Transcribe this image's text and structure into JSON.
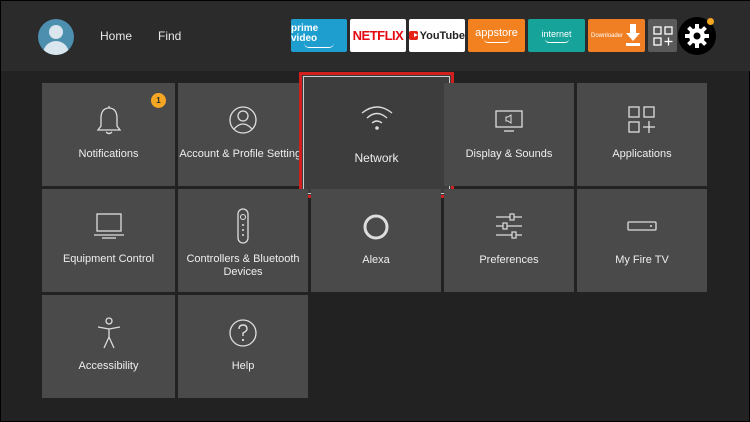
{
  "header": {
    "nav": [
      {
        "label": "Home"
      },
      {
        "label": "Find"
      }
    ],
    "apps": {
      "prime": "prime video",
      "netflix": "NETFLIX",
      "youtube": "YouTube",
      "appstore": "appstore",
      "internet": "internet",
      "downloader": "Downloader"
    }
  },
  "settings": {
    "tiles": [
      {
        "label": "Notifications",
        "badge": "1"
      },
      {
        "label": "Account & Profile Settings"
      },
      {
        "label": "Network"
      },
      {
        "label": "Display & Sounds"
      },
      {
        "label": "Applications"
      },
      {
        "label": "Equipment Control"
      },
      {
        "label": "Controllers & Bluetooth Devices"
      },
      {
        "label": "Alexa"
      },
      {
        "label": "Preferences"
      },
      {
        "label": "My Fire TV"
      },
      {
        "label": "Accessibility"
      },
      {
        "label": "Help"
      }
    ]
  },
  "colors": {
    "focus_border": "#d11f1f",
    "tile_bg": "#4a4a4a",
    "badge": "#f5a623"
  }
}
